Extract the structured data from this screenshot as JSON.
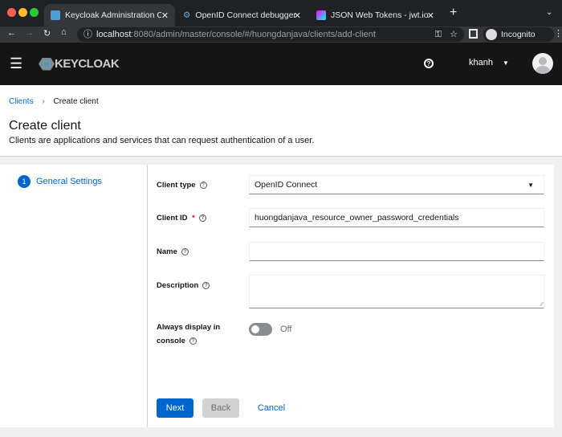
{
  "browser": {
    "tabs": [
      {
        "title": "Keycloak Administration Console"
      },
      {
        "title": "OpenID Connect debugger"
      },
      {
        "title": "JSON Web Tokens - jwt.io"
      }
    ],
    "url_host": "localhost",
    "url_rest": ":8080/admin/master/console/#/huongdanjava/clients/add-client",
    "profile": "Incognito"
  },
  "header": {
    "logo": "KEYCLOAK",
    "user": "khanh"
  },
  "breadcrumb": {
    "parent": "Clients",
    "sep": "›",
    "current": "Create client"
  },
  "page": {
    "title": "Create client",
    "subtitle": "Clients are applications and services that can request authentication of a user."
  },
  "wizard": {
    "step_number": "1",
    "step_label": "General Settings"
  },
  "form": {
    "client_type_label": "Client type",
    "client_type_value": "OpenID Connect",
    "client_id_label": "Client ID",
    "required_mark": "*",
    "client_id_value": "huongdanjava_resource_owner_password_credentials",
    "name_label": "Name",
    "name_value": "",
    "description_label": "Description",
    "description_value": "",
    "always_display_label_1": "Always display in",
    "always_display_label_2": "console",
    "always_display_state": "Off",
    "help_glyph": "?"
  },
  "buttons": {
    "next": "Next",
    "back": "Back",
    "cancel": "Cancel"
  }
}
